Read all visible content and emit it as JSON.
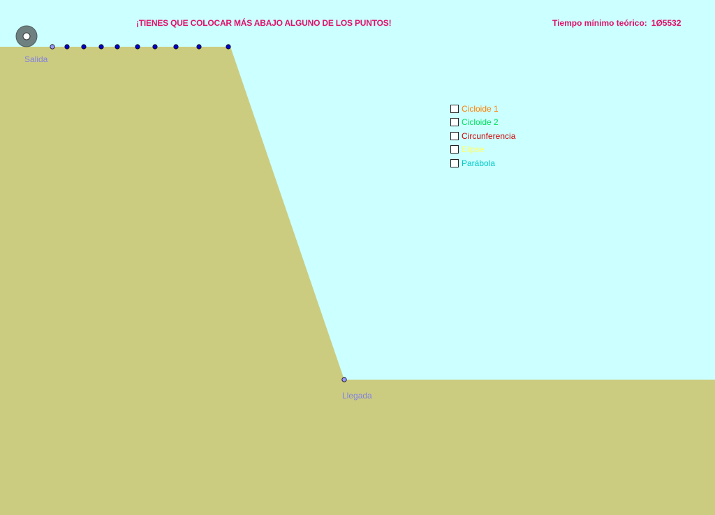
{
  "warning": "¡TIENES QUE COLOCAR MÁS ABAJO ALGUNO DE LOS PUNTOS!",
  "timer": {
    "label": "Tiempo mínimo teórico:",
    "value": "1Ø5532"
  },
  "start_label": "Salida",
  "end_label": "Llegada",
  "colors": {
    "sky": "#ccffff",
    "ground": "#cccc80",
    "point": "#0000cc",
    "endpoint": "#9999ff",
    "label": "#8080e6",
    "warning": "#e0106a"
  },
  "control_points_count": 10,
  "curves": [
    {
      "label": "Cicloide 1",
      "color": "#ff8000",
      "checked": false
    },
    {
      "label": "Cicloide 2",
      "color": "#00e060",
      "checked": false
    },
    {
      "label": "Circunferencia",
      "color": "#cc0000",
      "checked": false
    },
    {
      "label": "Elipse",
      "color": "#ffff66",
      "checked": false
    },
    {
      "label": "Parábola",
      "color": "#00c8c8",
      "checked": false
    }
  ]
}
